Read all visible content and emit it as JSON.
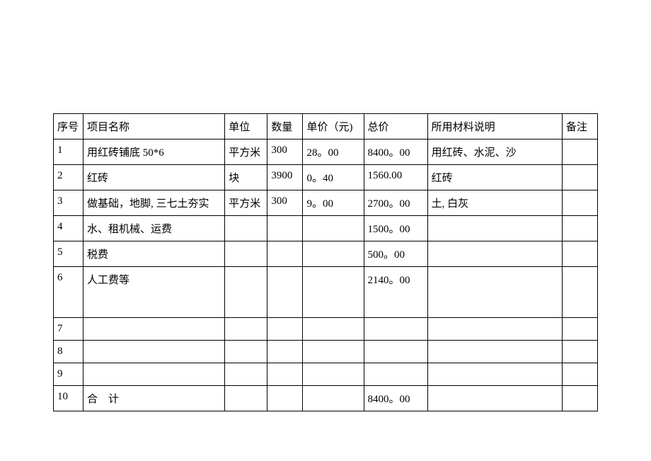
{
  "headers": {
    "no": "序号",
    "name": "项目名称",
    "unit": "单位",
    "qty": "数量",
    "price": "单价（元)",
    "total": "总价",
    "material": "所用材料说明",
    "remark": "备注"
  },
  "rows": [
    {
      "no": "1",
      "name": "用红砖铺底 50*6",
      "unit": "平方米",
      "qty": "300",
      "price": " 28。00",
      "total": "8400。00",
      "material": "用红砖、水泥、沙",
      "remark": ""
    },
    {
      "no": "2",
      "name": "红砖",
      "unit": "块",
      "qty": "3900",
      "price": "0。40",
      "total": "1560.00",
      "material": "红砖",
      "remark": ""
    },
    {
      "no": "3",
      "name": "做基础，地脚, 三七土夯实",
      "unit": "平方米",
      "qty": "300",
      "price": "9。00",
      "total": "2700。00",
      "material": "土, 白灰",
      "remark": ""
    },
    {
      "no": "4",
      "name": "水、租机械、运费",
      "unit": "",
      "qty": "",
      "price": "",
      "total": "1500。00",
      "material": "",
      "remark": ""
    },
    {
      "no": "5",
      "name": "税费",
      "unit": "",
      "qty": "",
      "price": "",
      "total": "500。00",
      "material": "",
      "remark": ""
    },
    {
      "no": "6",
      "name": "人工费等",
      "unit": "",
      "qty": "",
      "price": "",
      "total": "2140。00",
      "material": "",
      "remark": "",
      "tall": true
    },
    {
      "no": "7",
      "name": "",
      "unit": "",
      "qty": "",
      "price": "",
      "total": "",
      "material": "",
      "remark": ""
    },
    {
      "no": "8",
      "name": "",
      "unit": "",
      "qty": "",
      "price": "",
      "total": "",
      "material": "",
      "remark": ""
    },
    {
      "no": "9",
      "name": "",
      "unit": "",
      "qty": "",
      "price": "",
      "total": "",
      "material": "",
      "remark": ""
    },
    {
      "no": "10",
      "name": "合　计",
      "unit": "",
      "qty": "",
      "price": "",
      "total": "8400。00",
      "material": "",
      "remark": ""
    }
  ]
}
